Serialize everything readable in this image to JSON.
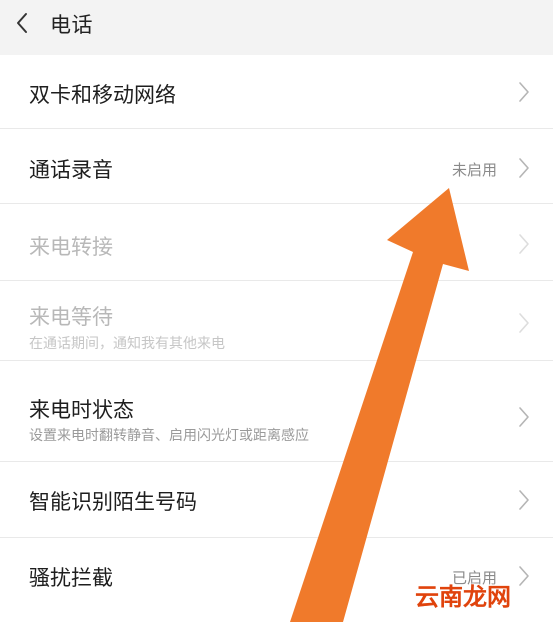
{
  "header": {
    "title": "电话"
  },
  "settings": {
    "items": [
      {
        "title": "双卡和移动网络",
        "value": "",
        "subtitle": ""
      },
      {
        "title": "通话录音",
        "value": "未启用",
        "subtitle": ""
      },
      {
        "title": "来电转接",
        "value": "",
        "subtitle": ""
      },
      {
        "title": "来电等待",
        "value": "",
        "subtitle": "在通话期间，通知我有其他来电"
      },
      {
        "title": "来电时状态",
        "value": "",
        "subtitle": "设置来电时翻转静音、启用闪光灯或距离感应"
      },
      {
        "title": "智能识别陌生号码",
        "value": "",
        "subtitle": ""
      },
      {
        "title": "骚扰拦截",
        "value": "已启用",
        "subtitle": ""
      }
    ]
  },
  "watermark": {
    "text": "云南龙网"
  },
  "colors": {
    "annotation_arrow": "#f07a2b",
    "watermark": "#e0430c"
  }
}
